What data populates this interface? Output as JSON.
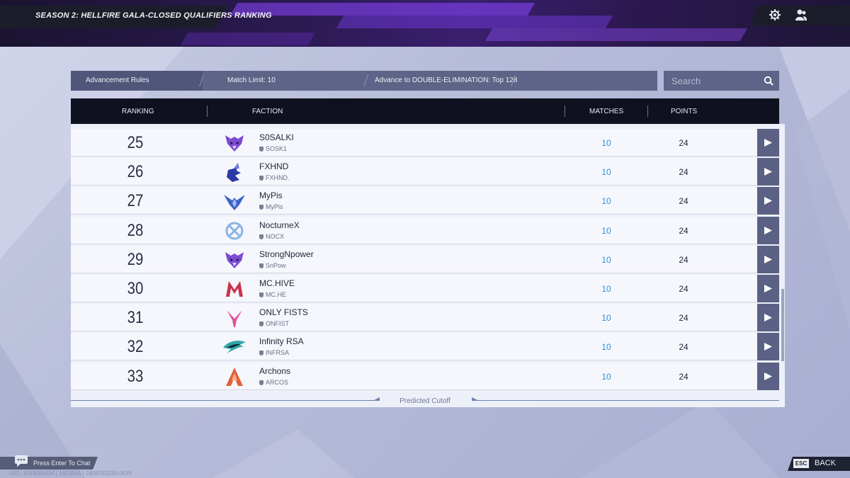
{
  "header": {
    "title": "SEASON 2: HELLFIRE GALA-CLOSED QUALIFIERS RANKING",
    "icons": [
      "gear-icon",
      "friends-icon"
    ]
  },
  "rules": {
    "label": "Advancement Rules",
    "match_limit": "Match Limit: 10",
    "advance": "Advance to DOUBLE-ELIMINATION: Top 128"
  },
  "search": {
    "placeholder": "Search"
  },
  "table": {
    "columns": {
      "ranking": "RANKING",
      "faction": "FACTION",
      "matches": "MATCHES",
      "points": "POINTS"
    },
    "rows": [
      {
        "rank": "25",
        "name": "S0SALKI",
        "tag": "SOSK1",
        "matches": "10",
        "points": "24",
        "logo": "wolf-purple",
        "color": "#7b4bd1"
      },
      {
        "rank": "26",
        "name": "FXHND",
        "tag": "FXHND.",
        "matches": "10",
        "points": "24",
        "logo": "fox-blue",
        "color": "#2b3aa3"
      },
      {
        "rank": "27",
        "name": "MyPis",
        "tag": "MyPis",
        "matches": "10",
        "points": "24",
        "logo": "bird-blue",
        "color": "#3d63c9"
      },
      {
        "rank": "28",
        "name": "NocturneX",
        "tag": "NOCX",
        "matches": "10",
        "points": "24",
        "logo": "x-circle",
        "color": "#8ab3e6"
      },
      {
        "rank": "29",
        "name": "StrongNpower",
        "tag": "SnPow",
        "matches": "10",
        "points": "24",
        "logo": "wolf-purple",
        "color": "#7b4bd1"
      },
      {
        "rank": "30",
        "name": "MC.HIVE",
        "tag": "MC.HE",
        "matches": "10",
        "points": "24",
        "logo": "m-letter",
        "color": "#c9334b"
      },
      {
        "rank": "31",
        "name": "ONLY FISTS",
        "tag": "ONFIST",
        "matches": "10",
        "points": "24",
        "logo": "y-letter",
        "color": "#e0509a"
      },
      {
        "rank": "32",
        "name": "Infinity RSA",
        "tag": "INFRSA",
        "matches": "10",
        "points": "24",
        "logo": "bird-teal",
        "color": "#2fa6a8"
      },
      {
        "rank": "33",
        "name": "Archons",
        "tag": "ARCOS",
        "matches": "10",
        "points": "24",
        "logo": "a-letter",
        "color": "#e0603a"
      }
    ]
  },
  "cutoff": {
    "label": "Predicted Cutoff"
  },
  "footer": {
    "chat": "Press Enter To Chat",
    "uid": "UID: 1583094434 | 1623545 | 2809152235-0439",
    "esc_key": "ESC",
    "back": "BACK"
  },
  "colors": {
    "banner_purple": "#3a1f6e",
    "header_dark": "#0f1120",
    "matches_blue": "#2f8fd6",
    "row_button": "#5a6184"
  }
}
